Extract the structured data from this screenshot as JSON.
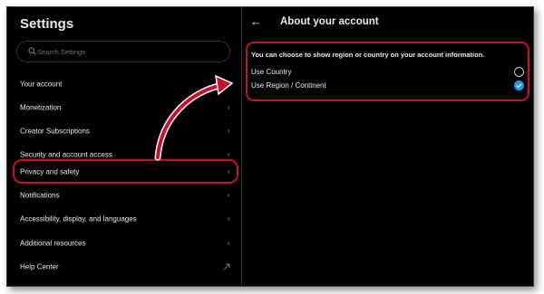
{
  "left": {
    "title": "Settings",
    "search_placeholder": "Search Settings",
    "items": [
      {
        "label": "Your account",
        "icon": "chevron-right-icon"
      },
      {
        "label": "Monetization",
        "icon": "chevron-right-icon"
      },
      {
        "label": "Creator Subscriptions",
        "icon": "chevron-right-icon"
      },
      {
        "label": "Security and account access",
        "icon": "chevron-right-icon"
      },
      {
        "label": "Privacy and safety",
        "icon": "chevron-right-icon",
        "selected": true
      },
      {
        "label": "Notifications",
        "icon": "chevron-right-icon"
      },
      {
        "label": "Accessibility, display, and languages",
        "icon": "chevron-right-icon"
      },
      {
        "label": "Additional resources",
        "icon": "chevron-right-icon"
      },
      {
        "label": "Help Center",
        "icon": "external-link-icon"
      }
    ]
  },
  "right": {
    "back_icon": "back-arrow-icon",
    "title": "About your account",
    "description": "You can choose to show region or country on your account information.",
    "options": [
      {
        "label": "Use Country",
        "checked": false
      },
      {
        "label": "Use Region / Continent",
        "checked": true
      }
    ]
  },
  "colors": {
    "background": "#000000",
    "text": "#e7e9ea",
    "muted": "#71767b",
    "accent": "#1d9bf0",
    "annotation": "#c8102e"
  }
}
